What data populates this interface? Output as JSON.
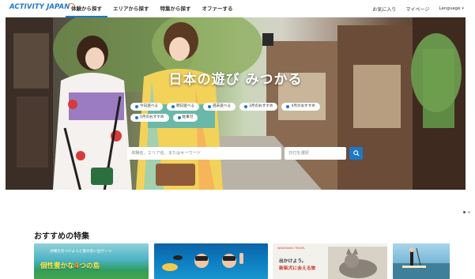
{
  "header": {
    "logo": "ACTIVITY JAPAN",
    "nav": [
      "体験から探す",
      "エリアから探す",
      "特集から探す",
      "オファーする"
    ],
    "active_nav": 0,
    "favorites": "お気に入り",
    "mypage": "マイページ",
    "language": "Language"
  },
  "hero": {
    "title": "日本の遊び みつかる",
    "chips": [
      "今日遊べる",
      "明日遊べる",
      "週末遊べる",
      "3月のおすすめ",
      "4月のおすすめ",
      "5月のおすすめ",
      "駐車可"
    ],
    "search_placeholder": "体験名、エリア名、またはキーワード",
    "date_placeholder": "日付を選択",
    "search_icon": "search-icon"
  },
  "carousel": {
    "pages": 2,
    "active": 0
  },
  "featured": {
    "title": "おすすめの特集",
    "card1_small": "沖縄を見つけようと旅の思い出が一つ",
    "card1_big_a": "個性豊かな",
    "card1_big_num": "4",
    "card1_big_b": "つの島",
    "card3_logo": "WAKUWAKU TRAVEL",
    "card3_line1": "出かけよう。",
    "card3_line2": "新柴犬に会える旅",
    "colors": {
      "accent": "#1e78c8",
      "logo_orange": "#e86f2c"
    }
  }
}
